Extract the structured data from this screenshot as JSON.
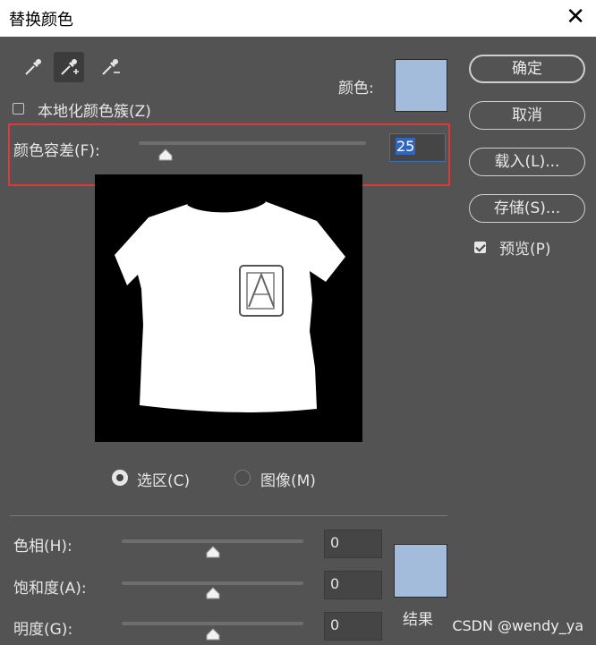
{
  "window": {
    "title": "替换颜色"
  },
  "tools": [
    {
      "name": "eyedropper"
    },
    {
      "name": "eyedropper-plus"
    },
    {
      "name": "eyedropper-minus"
    }
  ],
  "color_label": "颜色:",
  "color_swatch": "#a3bcdc",
  "localized_clusters": {
    "label": "本地化颜色簇(Z)",
    "checked": false
  },
  "fuzziness": {
    "label": "颜色容差(F):",
    "value": "25",
    "slider_percent": 12
  },
  "view": {
    "selection_label": "选区(C)",
    "image_label": "图像(M)",
    "selected": "selection"
  },
  "hue": {
    "label": "色相(H):",
    "value": "0"
  },
  "saturation": {
    "label": "饱和度(A):",
    "value": "0"
  },
  "lightness": {
    "label": "明度(G):",
    "value": "0"
  },
  "result": {
    "label": "结果",
    "color": "#a3bcdc"
  },
  "buttons": {
    "ok": "确定",
    "cancel": "取消",
    "load": "载入(L)...",
    "save": "存储(S)..."
  },
  "preview_check": {
    "label": "预览(P)",
    "checked": true
  },
  "watermark": "CSDN @wendy_ya"
}
